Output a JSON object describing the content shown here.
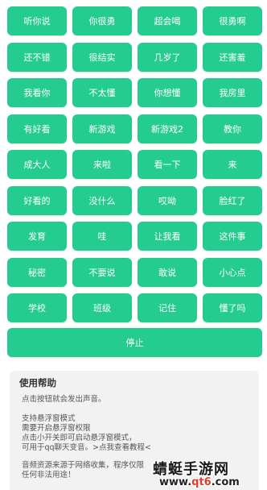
{
  "buttons": [
    "听你说",
    "你很勇",
    "超会喝",
    "很勇啊",
    "还不错",
    "很结实",
    "几岁了",
    "还害羞",
    "我看你",
    "不太懂",
    "你想懂",
    "我房里",
    "有好看",
    "新游戏",
    "新游戏2",
    "教你",
    "成大人",
    "来啦",
    "看一下",
    "来",
    "好看的",
    "没什么",
    "哎呦",
    "脸红了",
    "发育",
    "哇",
    "让我看",
    "这件事",
    "秘密",
    "不要说",
    "敢说",
    "小心点",
    "学校",
    "班级",
    "记住",
    "懂了吗"
  ],
  "stop_label": "停止",
  "help": {
    "title": "使用帮助",
    "line1": "点击按钮就会发出声音。",
    "line2": "支持悬浮窗模式",
    "line3": "需要开启悬浮窗权限",
    "line4": "点击小开关即可启动悬浮窗模式，",
    "line5": "可用于qq聊天变音。>点我查看教程<",
    "line6": "音频资源来源于网络收集，程序仅限",
    "line7": "任何非法用途！"
  },
  "watermark": {
    "name": "蜻蜓手游网",
    "url_prefix": "www.",
    "url_main": "qt6",
    "url_suffix": ".com"
  }
}
